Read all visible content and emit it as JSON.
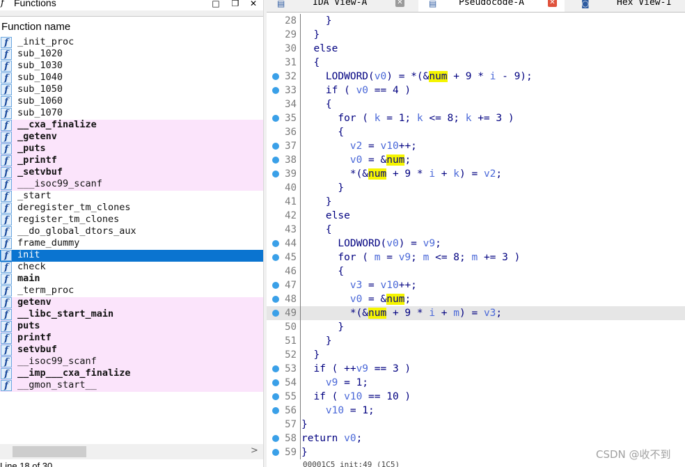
{
  "functions_pane": {
    "title": "Functions",
    "column_header": "Function name",
    "status_partial": "Line 18 of 30",
    "items": [
      {
        "name": "_init_proc",
        "style": "normal"
      },
      {
        "name": "sub_1020",
        "style": "normal"
      },
      {
        "name": "sub_1030",
        "style": "normal"
      },
      {
        "name": "sub_1040",
        "style": "normal"
      },
      {
        "name": "sub_1050",
        "style": "normal"
      },
      {
        "name": "sub_1060",
        "style": "normal"
      },
      {
        "name": "sub_1070",
        "style": "normal"
      },
      {
        "name": "__cxa_finalize",
        "style": "lib-bold"
      },
      {
        "name": "_getenv",
        "style": "lib-bold"
      },
      {
        "name": "_puts",
        "style": "lib-bold"
      },
      {
        "name": "_printf",
        "style": "lib-bold"
      },
      {
        "name": "_setvbuf",
        "style": "lib-bold"
      },
      {
        "name": "___isoc99_scanf",
        "style": "lib"
      },
      {
        "name": "_start",
        "style": "normal"
      },
      {
        "name": "deregister_tm_clones",
        "style": "normal"
      },
      {
        "name": "register_tm_clones",
        "style": "normal"
      },
      {
        "name": "__do_global_dtors_aux",
        "style": "normal"
      },
      {
        "name": "frame_dummy",
        "style": "normal"
      },
      {
        "name": "init",
        "style": "selected"
      },
      {
        "name": "check",
        "style": "normal"
      },
      {
        "name": "main",
        "style": "bold"
      },
      {
        "name": "_term_proc",
        "style": "normal"
      },
      {
        "name": "getenv",
        "style": "lib-bold"
      },
      {
        "name": "__libc_start_main",
        "style": "lib-bold"
      },
      {
        "name": "puts",
        "style": "lib-bold"
      },
      {
        "name": "printf",
        "style": "lib-bold"
      },
      {
        "name": "setvbuf",
        "style": "lib-bold"
      },
      {
        "name": "__isoc99_scanf",
        "style": "lib"
      },
      {
        "name": "__imp___cxa_finalize",
        "style": "lib-bold"
      },
      {
        "name": "__gmon_start__",
        "style": "lib"
      }
    ]
  },
  "tabs": [
    {
      "label": "IDA View-A",
      "active": false,
      "close_color": "#9a9a9a"
    },
    {
      "label": "Pseudocode-A",
      "active": true,
      "close_color": "#e0523c"
    },
    {
      "label": "Hex View-1",
      "active": false,
      "close_color": "#9a9a9a"
    }
  ],
  "code": {
    "highlight_word": "num",
    "current_line": 49,
    "lines": [
      {
        "n": 28,
        "bp": false,
        "t": "    }"
      },
      {
        "n": 29,
        "bp": false,
        "t": "  }"
      },
      {
        "n": 30,
        "bp": false,
        "t": "  else"
      },
      {
        "n": 31,
        "bp": false,
        "t": "  {"
      },
      {
        "n": 32,
        "bp": true,
        "t": "    LODWORD(v0) = *(&num + 9 * i - 9);"
      },
      {
        "n": 33,
        "bp": true,
        "t": "    if ( v0 == 4 )"
      },
      {
        "n": 34,
        "bp": false,
        "t": "    {"
      },
      {
        "n": 35,
        "bp": true,
        "t": "      for ( k = 1; k <= 8; k += 3 )"
      },
      {
        "n": 36,
        "bp": false,
        "t": "      {"
      },
      {
        "n": 37,
        "bp": true,
        "t": "        v2 = v10++;"
      },
      {
        "n": 38,
        "bp": true,
        "t": "        v0 = &num;"
      },
      {
        "n": 39,
        "bp": true,
        "t": "        *(&num + 9 * i + k) = v2;"
      },
      {
        "n": 40,
        "bp": false,
        "t": "      }"
      },
      {
        "n": 41,
        "bp": false,
        "t": "    }"
      },
      {
        "n": 42,
        "bp": false,
        "t": "    else"
      },
      {
        "n": 43,
        "bp": false,
        "t": "    {"
      },
      {
        "n": 44,
        "bp": true,
        "t": "      LODWORD(v0) = v9;"
      },
      {
        "n": 45,
        "bp": true,
        "t": "      for ( m = v9; m <= 8; m += 3 )"
      },
      {
        "n": 46,
        "bp": false,
        "t": "      {"
      },
      {
        "n": 47,
        "bp": true,
        "t": "        v3 = v10++;"
      },
      {
        "n": 48,
        "bp": true,
        "t": "        v0 = &num;"
      },
      {
        "n": 49,
        "bp": true,
        "t": "        *(&num + 9 * i + m) = v3;"
      },
      {
        "n": 50,
        "bp": false,
        "t": "      }"
      },
      {
        "n": 51,
        "bp": false,
        "t": "    }"
      },
      {
        "n": 52,
        "bp": false,
        "t": "  }"
      },
      {
        "n": 53,
        "bp": true,
        "t": "  if ( ++v9 == 3 )"
      },
      {
        "n": 54,
        "bp": true,
        "t": "    v9 = 1;"
      },
      {
        "n": 55,
        "bp": true,
        "t": "  if ( v10 == 10 )"
      },
      {
        "n": 56,
        "bp": true,
        "t": "    v10 = 1;"
      },
      {
        "n": 57,
        "bp": false,
        "t": "}"
      },
      {
        "n": 58,
        "bp": true,
        "t": "return v0;"
      },
      {
        "n": 59,
        "bp": true,
        "t": "}"
      }
    ],
    "status_partial": "00001C5 init:49 (1C5) "
  },
  "watermark": "CSDN @收不到",
  "colors": {
    "selection": "#0a74d0",
    "library_row": "#fbe4fb",
    "breakpoint": "#3aa0e8",
    "highlight": "#f5f500",
    "code_text": "#000080",
    "variable": "#4a68d8"
  }
}
